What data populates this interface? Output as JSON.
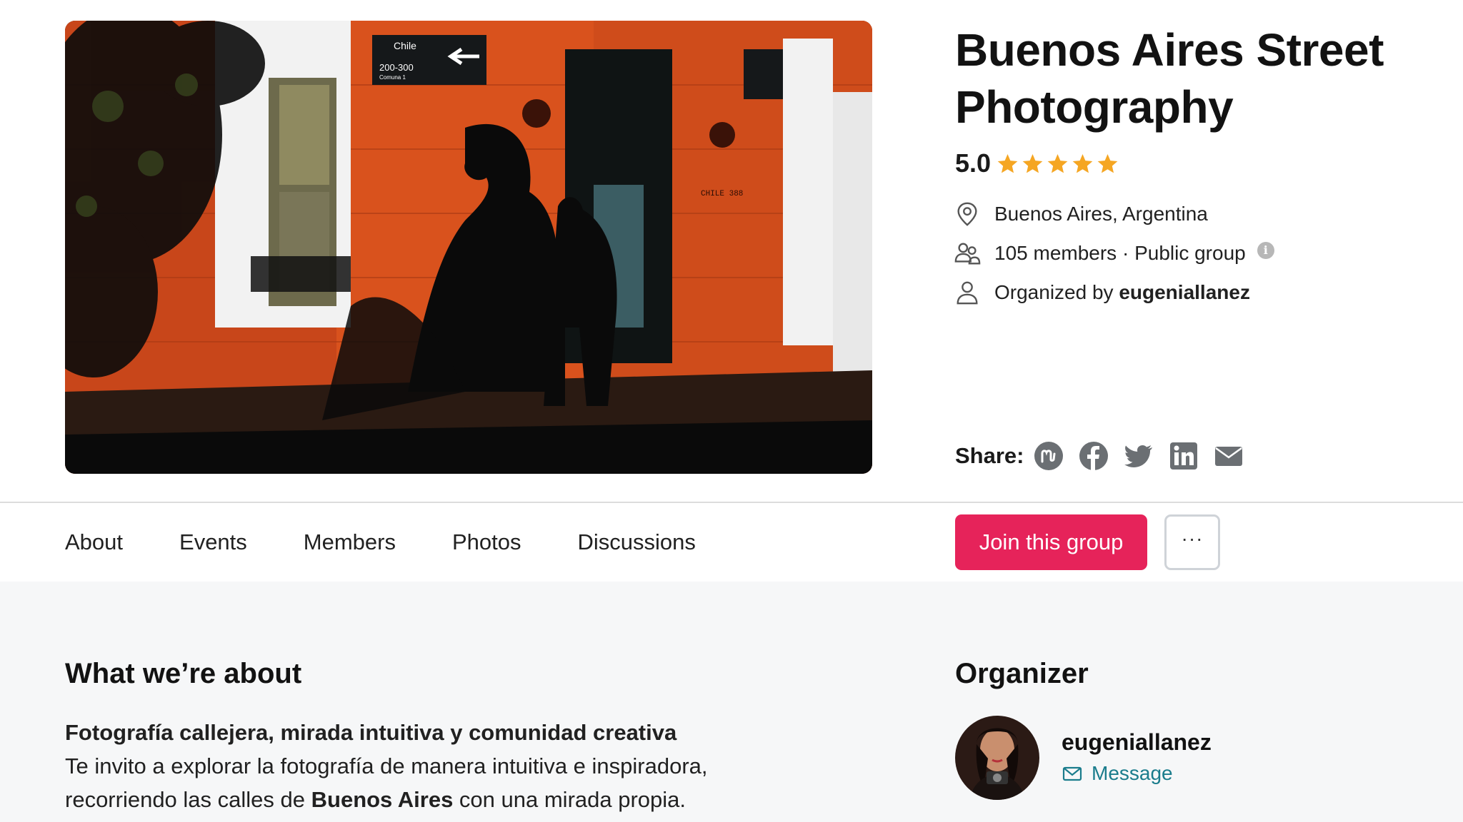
{
  "group": {
    "title": "Buenos Aires Street Photography",
    "rating": "5.0",
    "stars": 5,
    "location": "Buenos Aires, Argentina",
    "members_text": "105 members · Public group",
    "organized_prefix": "Organized by ",
    "organizer": "eugeniallanez"
  },
  "hero": {
    "sign_street": "Chile",
    "sign_number": "200-300",
    "sign_sub": "Comuna 1",
    "wall_plate": "CHILE 388"
  },
  "share": {
    "label": "Share:",
    "icons": [
      "meetup-icon",
      "facebook-icon",
      "twitter-icon",
      "linkedin-icon",
      "email-icon"
    ]
  },
  "tabs": [
    "About",
    "Events",
    "Members",
    "Photos",
    "Discussions"
  ],
  "actions": {
    "join_label": "Join this group",
    "more_label": "···"
  },
  "about": {
    "heading": "What we’re about",
    "subtitle": "Fotografía callejera, mirada intuitiva y comunidad creativa",
    "line1": "Te invito a explorar la fotografía de manera intuitiva e inspiradora,",
    "line2_prefix": "recorriendo las calles de ",
    "line2_bold": "Buenos Aires",
    "line2_suffix": " con una mirada propia."
  },
  "organizer_card": {
    "heading": "Organizer",
    "name": "eugeniallanez",
    "message_label": "Message"
  },
  "colors": {
    "join_button": "#e6235a",
    "star": "#f5a623",
    "message_link": "#1a7c8c",
    "wall_orange": "#d9521d"
  }
}
